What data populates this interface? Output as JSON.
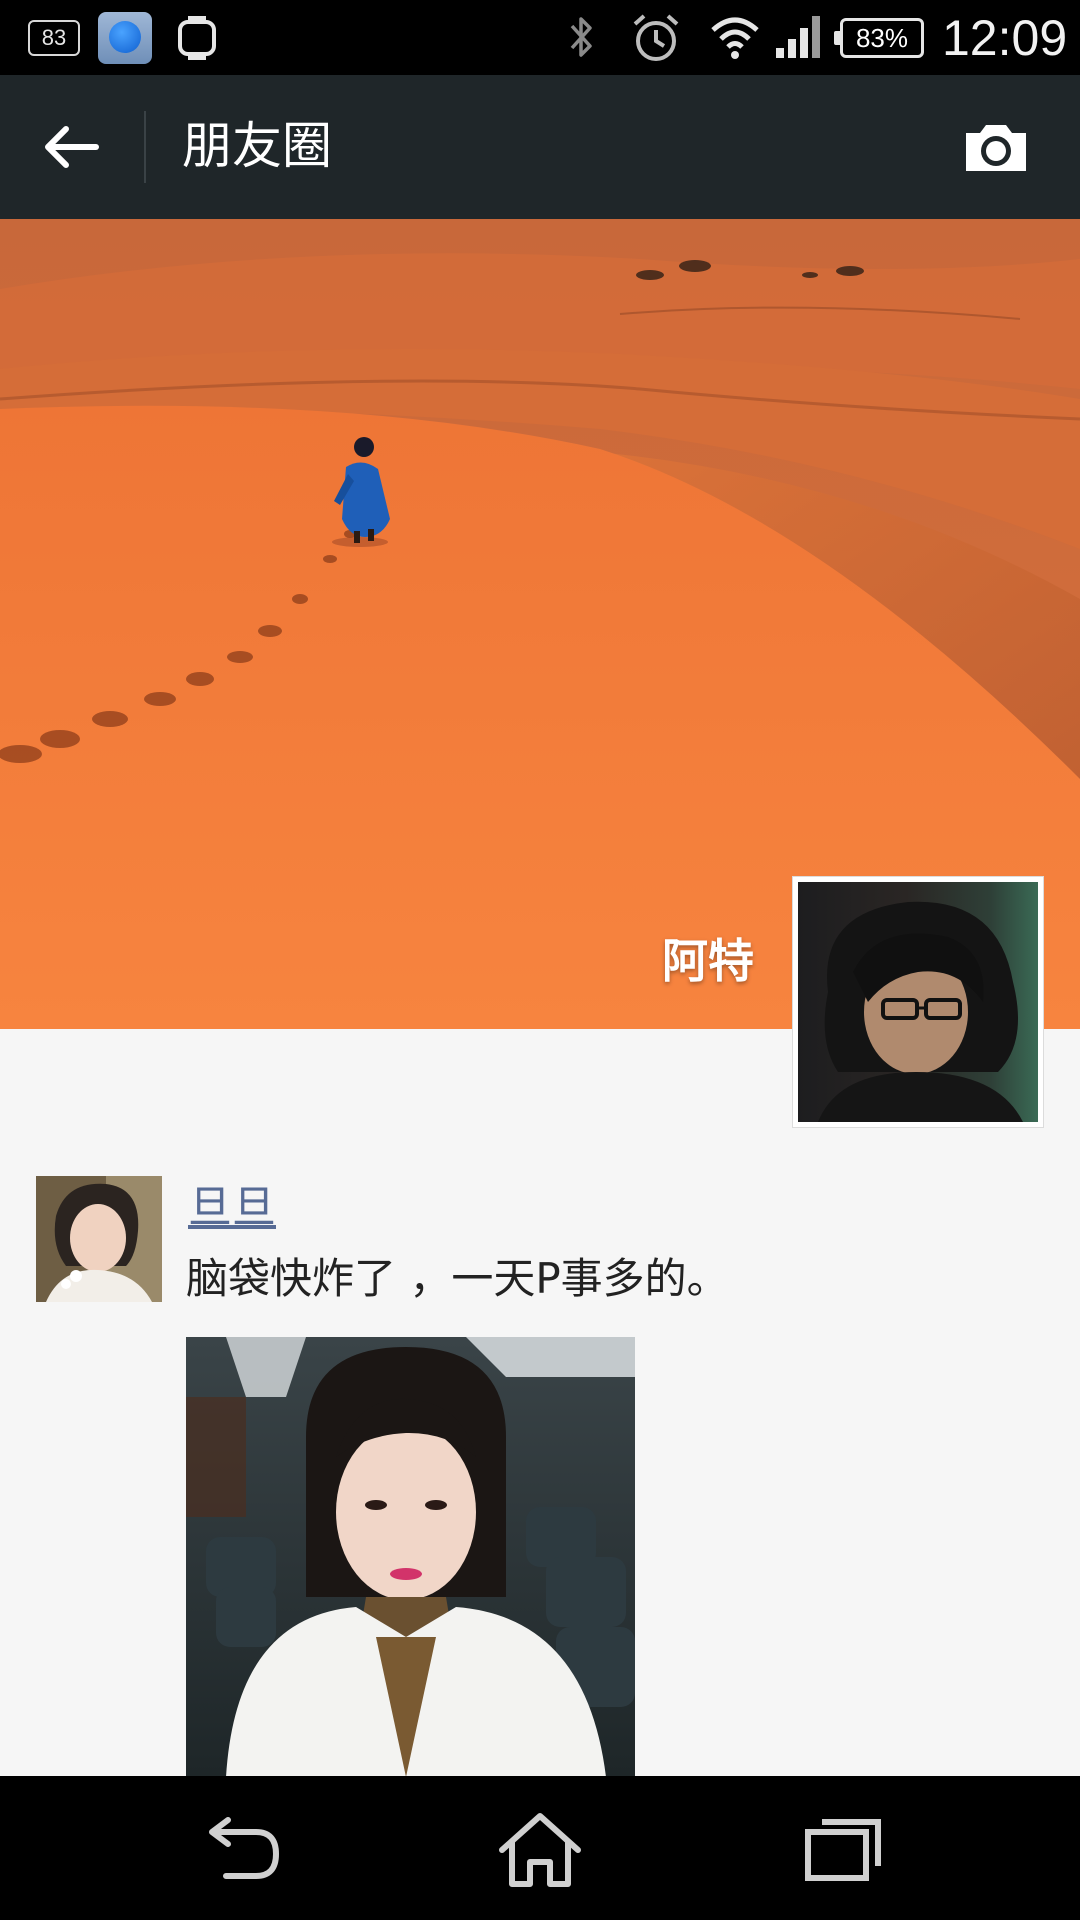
{
  "status_bar": {
    "notification_count": "83",
    "battery_percent": "83%",
    "time": "12:09",
    "icons": [
      "notification-count-icon",
      "app-icon",
      "smartwatch-icon",
      "bluetooth-icon",
      "alarm-icon",
      "wifi-icon",
      "signal-icon",
      "battery-icon"
    ]
  },
  "app_bar": {
    "title": "朋友圈",
    "back_icon": "arrow-left-icon",
    "camera_icon": "camera-icon",
    "background": "#1f2629"
  },
  "cover": {
    "user_name": "阿特",
    "accent": "#f0773a"
  },
  "post": {
    "author": "旦旦",
    "text": "脑袋快炸了 ，一天P事多的。",
    "name_color": "#576b95"
  },
  "nav_bar": {
    "icons": [
      "back-nav-icon",
      "home-nav-icon",
      "recent-apps-icon"
    ]
  }
}
